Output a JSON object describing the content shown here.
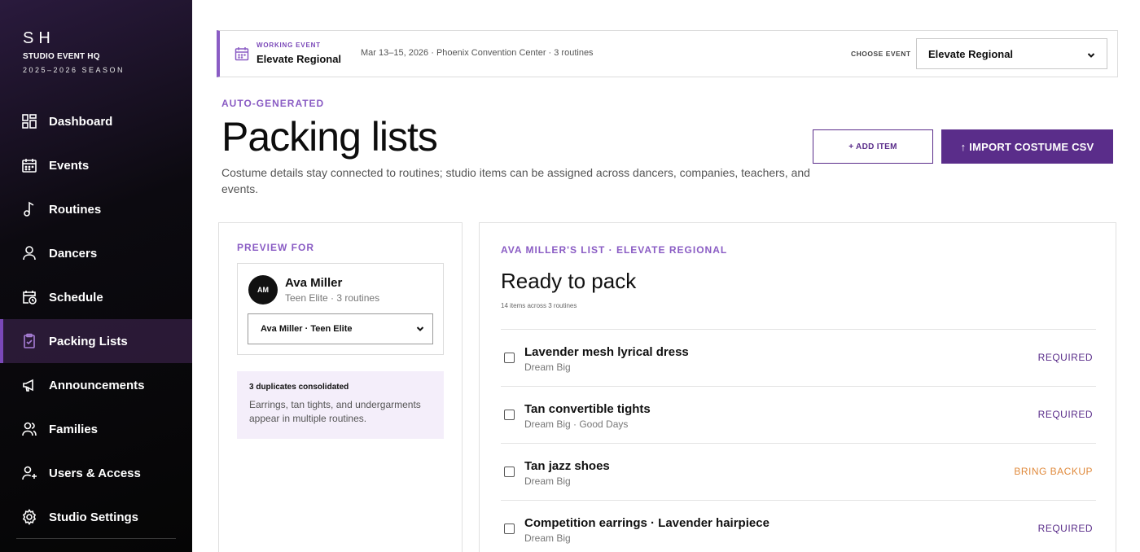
{
  "brand": {
    "mark": "SH",
    "name": "STUDIO EVENT HQ",
    "season": "2025–2026 SEASON"
  },
  "sidebar": {
    "items": [
      {
        "label": "Dashboard",
        "icon": "grid-icon"
      },
      {
        "label": "Events",
        "icon": "calendar-icon"
      },
      {
        "label": "Routines",
        "icon": "music-note-icon"
      },
      {
        "label": "Dancers",
        "icon": "person-icon"
      },
      {
        "label": "Schedule",
        "icon": "calendar-clock-icon"
      },
      {
        "label": "Packing Lists",
        "icon": "clipboard-check-icon",
        "active": true
      },
      {
        "label": "Announcements",
        "icon": "megaphone-icon"
      },
      {
        "label": "Families",
        "icon": "people-icon"
      },
      {
        "label": "Users & Access",
        "icon": "user-plus-icon"
      },
      {
        "label": "Studio Settings",
        "icon": "gear-icon"
      }
    ]
  },
  "event_bar": {
    "label": "WORKING EVENT",
    "name": "Elevate Regional",
    "meta": "Mar 13–15, 2026 · Phoenix Convention Center · 3 routines",
    "choose_label": "CHOOSE EVENT",
    "selected": "Elevate Regional"
  },
  "header": {
    "eyebrow": "AUTO-GENERATED",
    "title": "Packing lists",
    "description": "Costume details stay connected to routines; studio items can be assigned across dancers, companies, teachers, and events.",
    "add_label": "+ ADD ITEM",
    "import_arrow": "↑",
    "import_label": "IMPORT COSTUME CSV"
  },
  "preview": {
    "label": "PREVIEW FOR",
    "avatar_initials": "AM",
    "dancer_name": "Ava Miller",
    "dancer_meta": "Teen Elite · 3 routines",
    "selected": "Ava Miller · Teen Elite",
    "dup_title": "3 duplicates consolidated",
    "dup_text": "Earrings, tan tights, and undergarments appear in multiple routines."
  },
  "list": {
    "label": "AVA MILLER'S LIST · ELEVATE REGIONAL",
    "title": "Ready to pack",
    "subtitle": "14 items across 3 routines",
    "items": [
      {
        "name": "Lavender mesh lyrical dress",
        "sub": "Dream Big",
        "tag": "REQUIRED",
        "tag_color": "#5a2d8a"
      },
      {
        "name": "Tan convertible tights",
        "sub": "Dream Big · Good Days",
        "tag": "REQUIRED",
        "tag_color": "#5a2d8a"
      },
      {
        "name": "Tan jazz shoes",
        "sub": "Dream Big",
        "tag": "BRING BACKUP",
        "tag_color": "#e08a3c"
      },
      {
        "name": "Competition earrings · Lavender hairpiece",
        "sub": "Dream Big",
        "tag": "REQUIRED",
        "tag_color": "#5a2d8a"
      }
    ]
  },
  "colors": {
    "accent": "#8a5cc4",
    "brand_dark": "#5a2d8a",
    "backup": "#e08a3c"
  }
}
